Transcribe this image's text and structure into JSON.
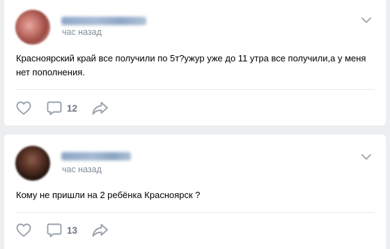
{
  "colors": {
    "background": "#edeef0",
    "card": "#ffffff",
    "secondary_text": "#818c99",
    "icon": "#99a2ad"
  },
  "posts": [
    {
      "time": "час назад",
      "text": "Красноярский край все получили по 5т?ужур уже до 11 утра все получили,а у меня нет пополнения.",
      "comments": "12",
      "icons": [
        "like-icon",
        "comment-icon",
        "share-icon",
        "chevron-down-icon"
      ]
    },
    {
      "time": "час назад",
      "text": "Кому не пришли на 2 ребёнка Красноярск ?",
      "comments": "13",
      "icons": [
        "like-icon",
        "comment-icon",
        "share-icon",
        "chevron-down-icon"
      ]
    }
  ]
}
